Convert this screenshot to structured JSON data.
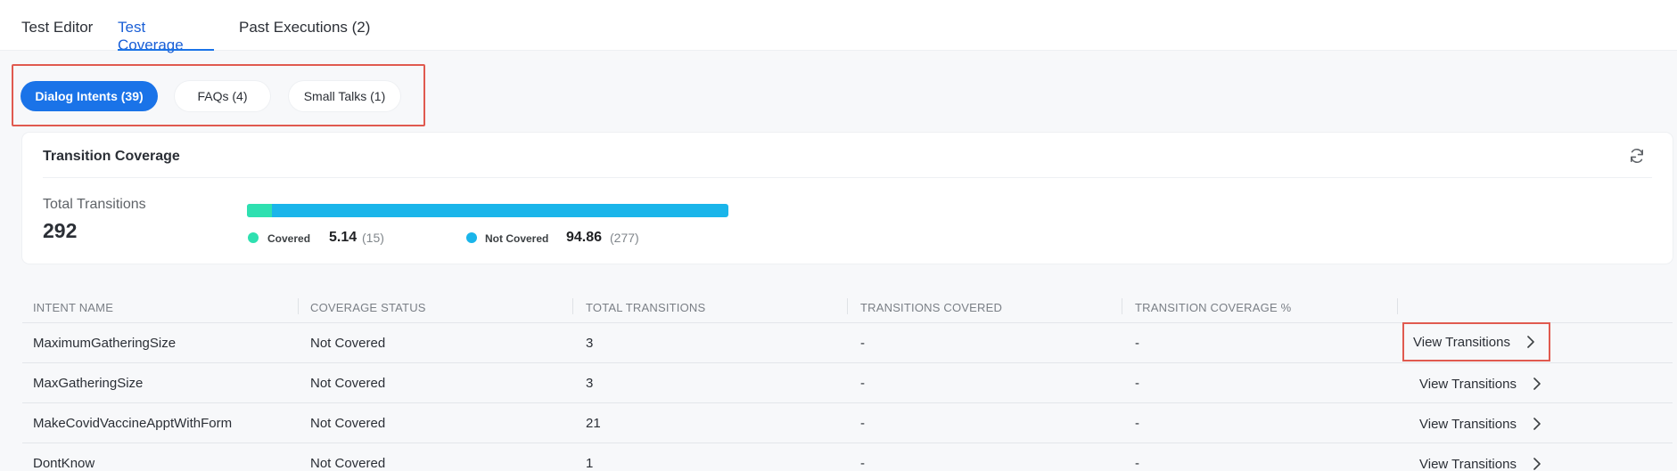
{
  "tabs": {
    "editor": "Test Editor",
    "coverage": "Test Coverage",
    "executions": "Past Executions (2)"
  },
  "filters": {
    "dialog": "Dialog Intents (39)",
    "faqs": "FAQs (4)",
    "small_talks": "Small Talks (1)"
  },
  "coverage_card": {
    "title": "Transition Coverage",
    "total_label": "Total Transitions",
    "total_value": "292",
    "covered_fraction": 0.0514,
    "covered_label": "Covered",
    "covered_pct": "5.14",
    "covered_count": "(15)",
    "not_covered_label": "Not Covered",
    "not_covered_pct": "94.86",
    "not_covered_count": "(277)",
    "covered_color": "#2ee0b0",
    "not_covered_color": "#1ab5ea",
    "refresh_icon": "refresh-icon"
  },
  "table": {
    "headers": [
      "INTENT NAME",
      "COVERAGE STATUS",
      "TOTAL TRANSITIONS",
      "TRANSITIONS COVERED",
      "TRANSITION COVERAGE %"
    ],
    "action_label": "View Transitions",
    "rows": [
      {
        "name": "MaximumGatheringSize",
        "status": "Not Covered",
        "total": "3",
        "covered": "-",
        "pct": "-"
      },
      {
        "name": "MaxGatheringSize",
        "status": "Not Covered",
        "total": "3",
        "covered": "-",
        "pct": "-"
      },
      {
        "name": "MakeCovidVaccineApptWithForm",
        "status": "Not Covered",
        "total": "21",
        "covered": "-",
        "pct": "-"
      },
      {
        "name": "DontKnow",
        "status": "Not Covered",
        "total": "1",
        "covered": "-",
        "pct": "-"
      }
    ]
  },
  "accent_color": "#1a73e8",
  "highlight_color": "#e05a4f"
}
